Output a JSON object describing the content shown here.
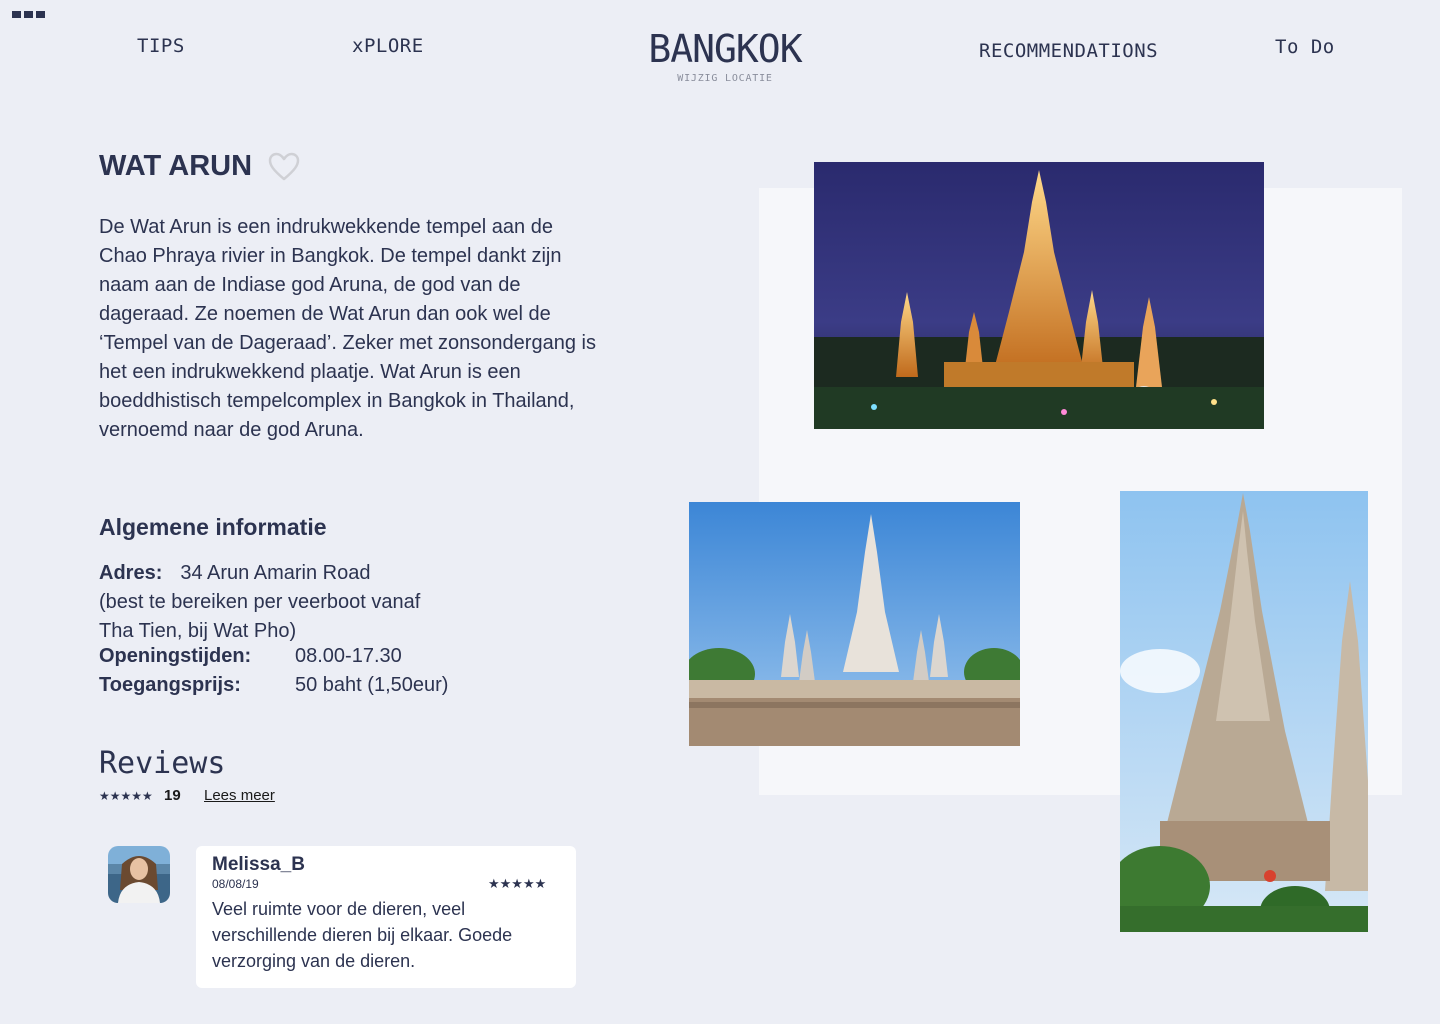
{
  "nav": {
    "tips": "TIPS",
    "explore": "xPLORE",
    "recommendations": "RECOMMENDATIONS",
    "todo": "To Do"
  },
  "header": {
    "city": "BANGKOK",
    "change_location": "WIJZIG LOCATIE"
  },
  "attraction": {
    "title": "WAT ARUN",
    "description": "De Wat Arun is een indrukwekkende tempel aan de Chao Phraya rivier in Bangkok. De tempel dankt zijn naam aan de Indiase god Aruna, de god van de dageraad. Ze noemen de Wat Arun dan ook wel de ‘Tempel van de Dageraad’. Zeker met zonsondergang is het een indrukwekkend plaatje. Wat Arun is een boeddhistisch tempelcomplex in Bangkok in Thailand, vernoemd naar de god Aruna."
  },
  "info": {
    "section_title": "Algemene informatie",
    "address_label": "Adres:",
    "address_value": "34 Arun Amarin Road",
    "address_note_1": "(best te bereiken per veerboot vanaf",
    "address_note_2": "Tha Tien, bij Wat Pho)",
    "hours_label": "Openingstijden:",
    "hours_value": "08.00-17.30",
    "price_label": "Toegangsprijs:",
    "price_value": "50 baht  (1,50eur)"
  },
  "reviews": {
    "title": "Reviews",
    "rating_stars": "★★★★★",
    "count": "19",
    "read_more": "Lees meer",
    "items": [
      {
        "author": "Melissa_B",
        "date": "08/08/19",
        "stars": "★★★★★",
        "text": "Veel ruimte voor de dieren, veel verschillende dieren bij elkaar. Goede verzorging van de dieren."
      }
    ]
  },
  "colors": {
    "background": "#eceef5",
    "text": "#2c3350",
    "card": "#ffffff",
    "photo_panel": "#f6f7fa"
  }
}
